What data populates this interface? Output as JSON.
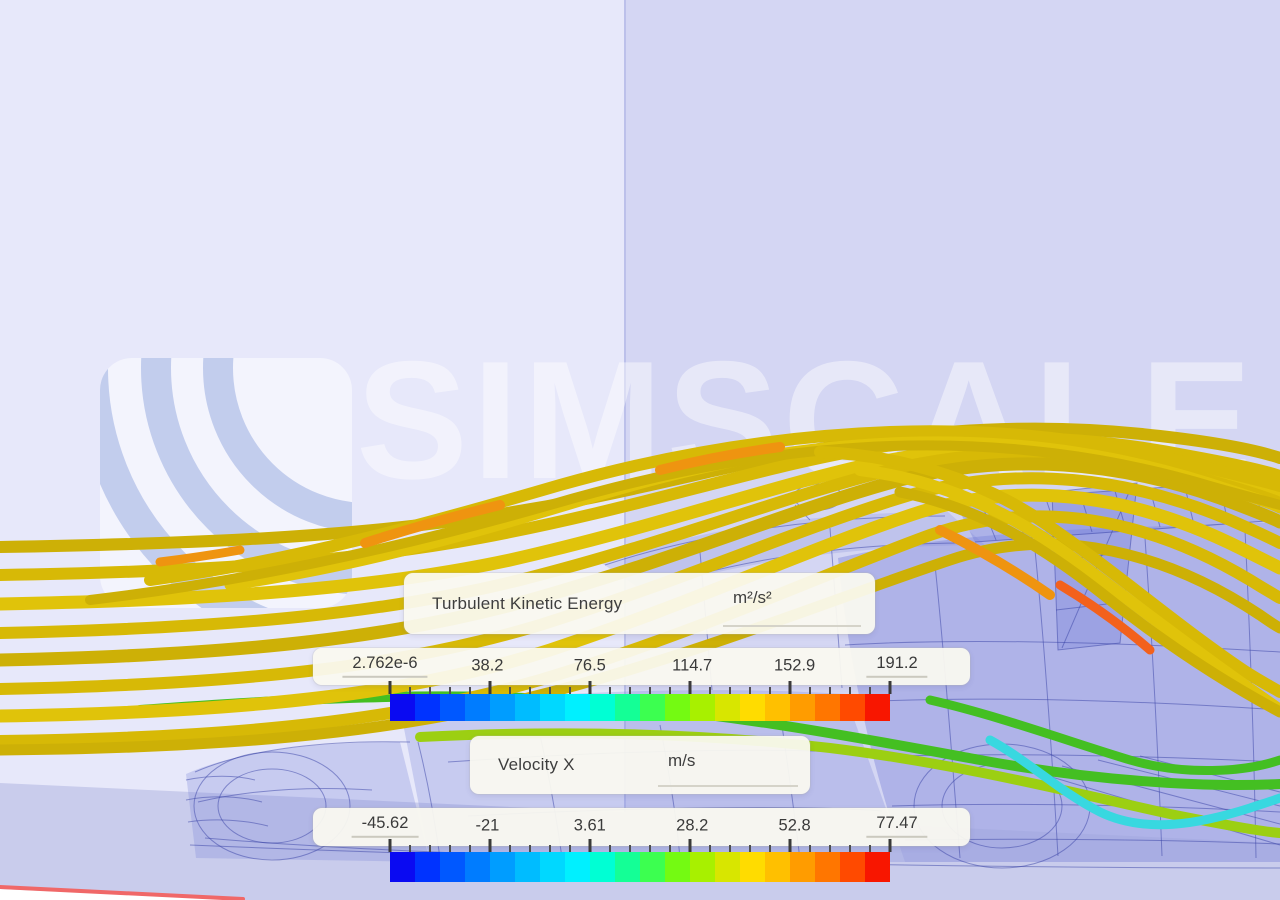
{
  "watermark": {
    "brand": "SIMSCALE"
  },
  "scene": {
    "colors": {
      "bg_left": "#e7e8fa",
      "bg_right": "#d4d6f3",
      "divider": "#bcc0ea",
      "floor": "#c9ccec",
      "axis_edge": "#f06868",
      "streamline_yellow": "#d7b906",
      "streamline_orange": "#ef9410",
      "streamline_green": "#44bf22",
      "streamline_cyan": "#38d8e0",
      "car_body": "#7880d8",
      "car_wire": "#3741a5"
    }
  },
  "colormap": [
    "#0a0af2",
    "#0033ff",
    "#0058ff",
    "#007cff",
    "#009dff",
    "#00bcff",
    "#00d8ff",
    "#00f0ff",
    "#00ffd4",
    "#14ff96",
    "#3cff50",
    "#74fa12",
    "#a8f000",
    "#d8e600",
    "#ffdc00",
    "#ffc000",
    "#ff9c00",
    "#ff7600",
    "#ff4a00",
    "#f81600"
  ],
  "legends": {
    "tke": {
      "title": "Turbulent Kinetic Energy",
      "unit": "m²/s²",
      "ticks": [
        "2.762e-6",
        "38.2",
        "76.5",
        "114.7",
        "152.9",
        "191.2"
      ]
    },
    "vx": {
      "title": "Velocity X",
      "unit": "m/s",
      "ticks": [
        "-45.62",
        "-21",
        "3.61",
        "28.2",
        "52.8",
        "77.47"
      ]
    }
  }
}
